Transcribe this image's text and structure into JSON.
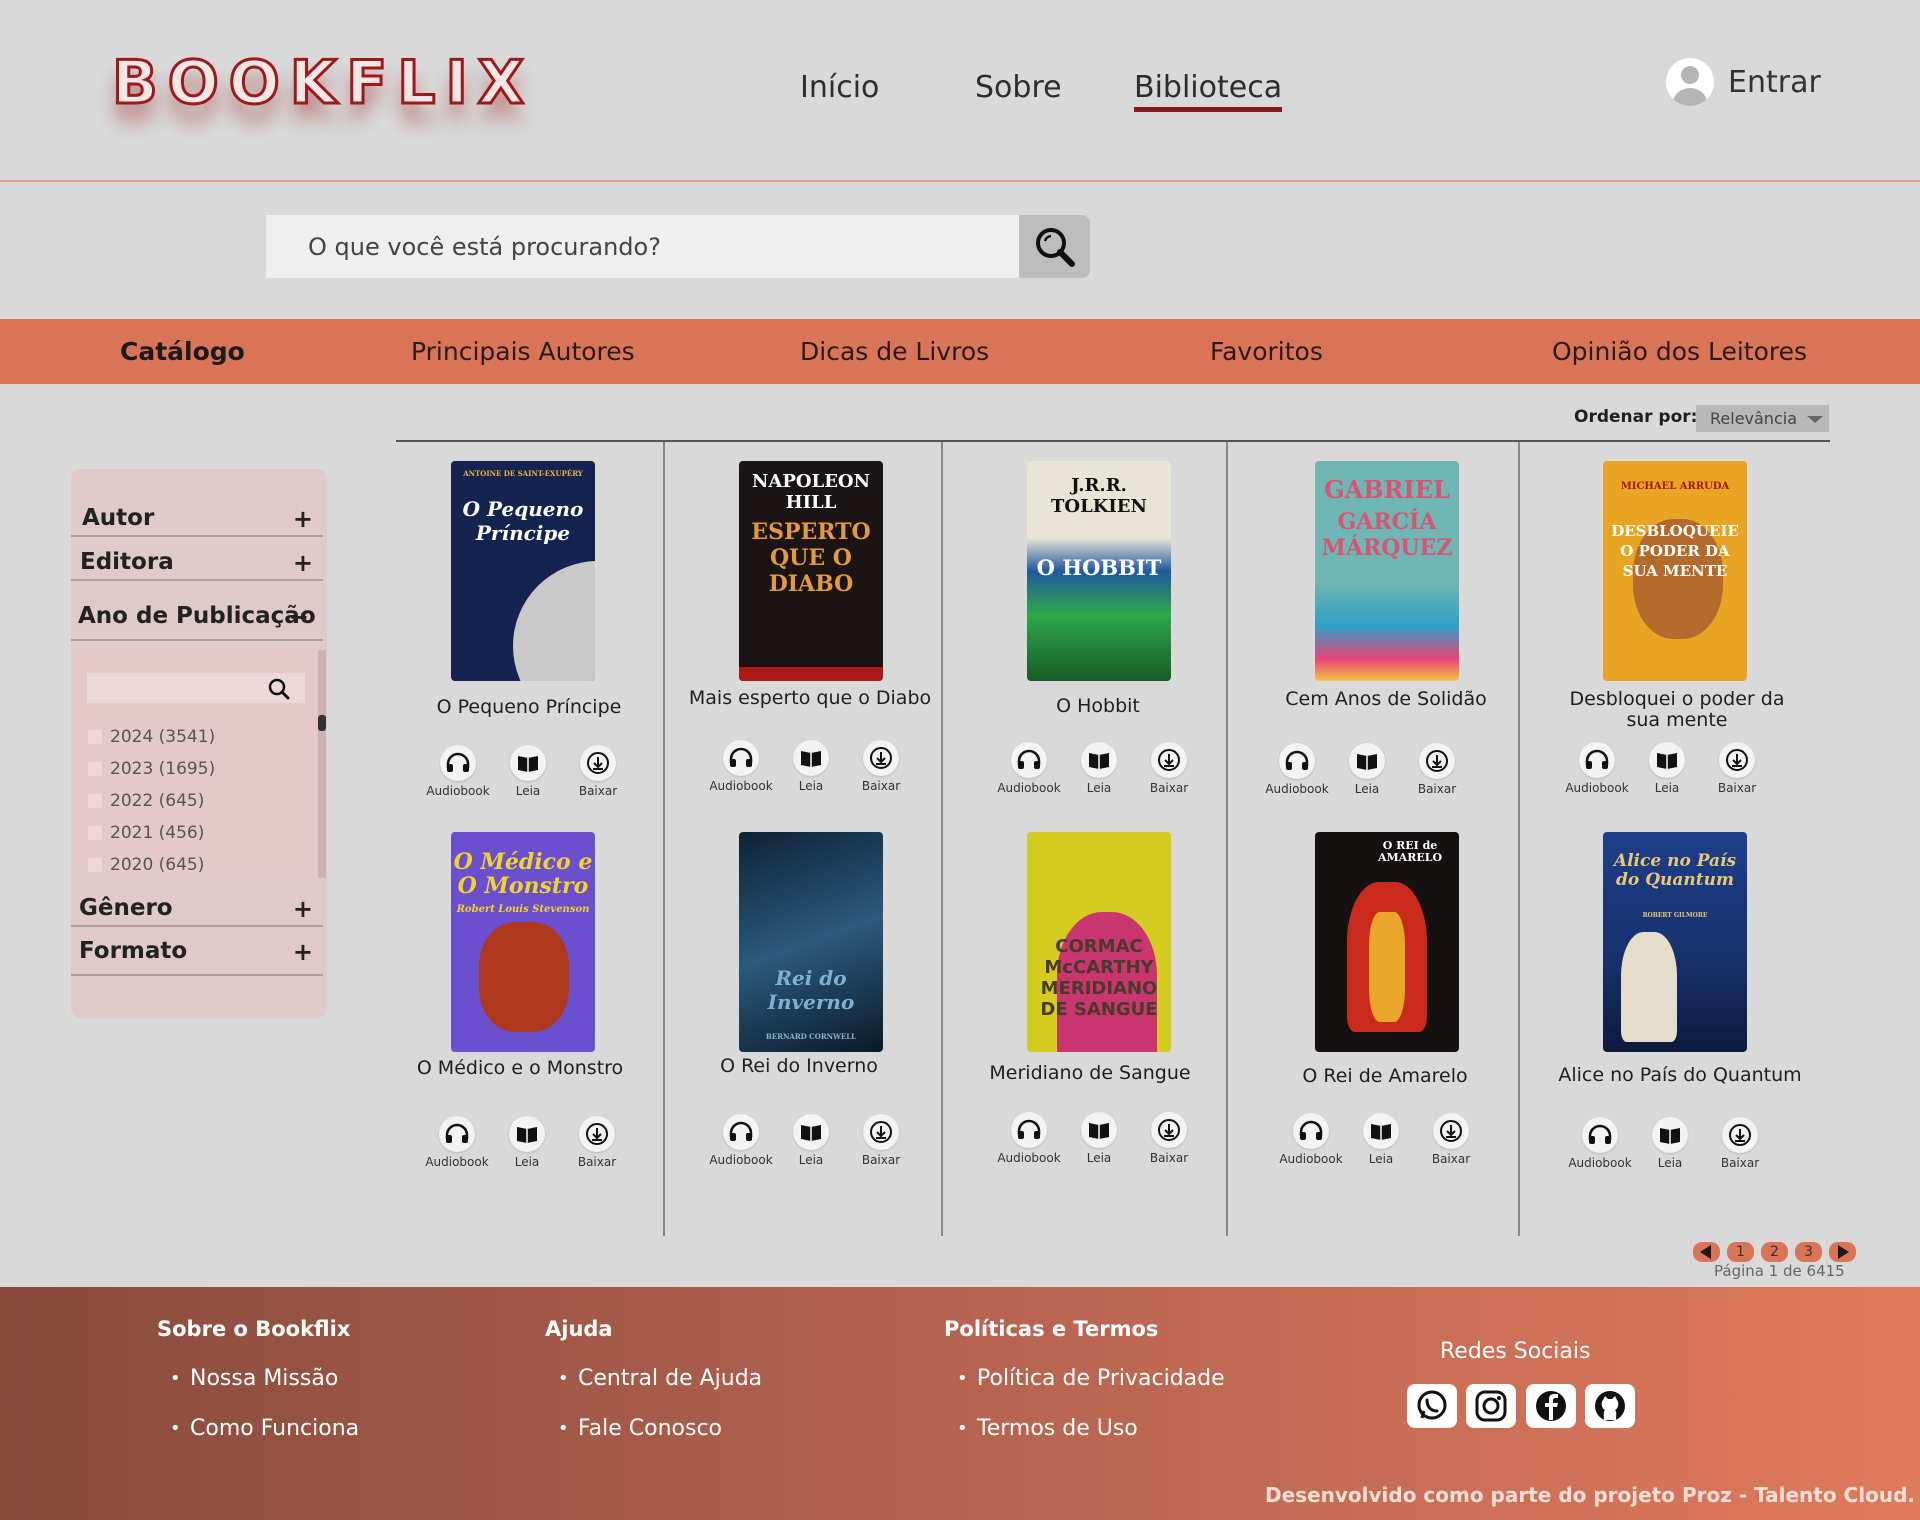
{
  "header": {
    "logo": "BOOKFLIX",
    "nav": [
      {
        "label": "Início",
        "active": false
      },
      {
        "label": "Sobre",
        "active": false
      },
      {
        "label": "Biblioteca",
        "active": true
      }
    ],
    "login_label": "Entrar"
  },
  "search": {
    "placeholder": "O que você está procurando?",
    "button_icon": "search-icon"
  },
  "categories": [
    {
      "label": "Catálogo",
      "active": true
    },
    {
      "label": "Principais Autores",
      "active": false
    },
    {
      "label": "Dicas de Livros",
      "active": false
    },
    {
      "label": "Favoritos",
      "active": false
    },
    {
      "label": "Opinião dos Leitores",
      "active": false
    }
  ],
  "sort": {
    "label": "Ordenar por:",
    "value": "Relevância"
  },
  "filters": {
    "autor": {
      "label": "Autor",
      "sign": "+"
    },
    "editora": {
      "label": "Editora",
      "sign": "+"
    },
    "ano": {
      "label": "Ano de Publicação",
      "sign": "−"
    },
    "genero": {
      "label": "Gênero",
      "sign": "+"
    },
    "formato": {
      "label": "Formato",
      "sign": "+"
    },
    "years": [
      "2024 (3541)",
      "2023 (1695)",
      "2022 (645)",
      "2021 (456)",
      "2020 (645)"
    ]
  },
  "actions": {
    "audiobook": "Audiobook",
    "leia": "Leia",
    "baixar": "Baixar"
  },
  "books": [
    {
      "title": "O Pequeno Príncipe",
      "cover_text": "O Pequeno Príncipe",
      "cover_author": "ANTOINE DE SAINT-EXUPÉRY"
    },
    {
      "title": "Mais esperto que o Diabo",
      "cover_text": "ESPERTO QUE O DIABO",
      "cover_author": "NAPOLEON HILL"
    },
    {
      "title": "O Hobbit",
      "cover_text": "O HOBBIT",
      "cover_author": "J.R.R. TOLKIEN"
    },
    {
      "title": "Cem Anos de Solidão",
      "cover_text": "GARCÍA MÁRQUEZ",
      "cover_author": "GABRIEL"
    },
    {
      "title": "Desbloquei o poder da sua mente",
      "cover_text": "DESBLOQUEIE O PODER DA SUA MENTE",
      "cover_author": "MICHAEL ARRUDA"
    },
    {
      "title": "O Médico e o Monstro",
      "cover_text": "O Médico e O Monstro",
      "cover_author": "Robert Louis Stevenson"
    },
    {
      "title": "O Rei do Inverno",
      "cover_text": "Rei do Inverno",
      "cover_author": "BERNARD CORNWELL"
    },
    {
      "title": "Meridiano de Sangue",
      "cover_text": "CORMAC McCARTHY MERIDIANO DE SANGUE",
      "cover_author": ""
    },
    {
      "title": "O Rei de Amarelo",
      "cover_text": "O REI de AMARELO",
      "cover_author": ""
    },
    {
      "title": "Alice no País do Quantum",
      "cover_text": "Alice no País do Quantum",
      "cover_author": "ROBERT GILMORE"
    }
  ],
  "pagination": {
    "pages": [
      "1",
      "2",
      "3"
    ],
    "info": "Página 1 de 6415"
  },
  "footer": {
    "col1": {
      "title": "Sobre o Bookflix",
      "links": [
        "Nossa Missão",
        "Como Funciona"
      ]
    },
    "col2": {
      "title": "Ajuda",
      "links": [
        "Central de Ajuda",
        "Fale Conosco"
      ]
    },
    "col3": {
      "title": "Políticas e Termos",
      "links": [
        "Política de Privacidade",
        "Termos de Uso"
      ]
    },
    "social_title": "Redes Sociais",
    "social_icons": [
      "whatsapp-icon",
      "instagram-icon",
      "facebook-icon",
      "github-icon"
    ],
    "credit": "Desenvolvido como parte do projeto Proz - Talento Cloud."
  }
}
